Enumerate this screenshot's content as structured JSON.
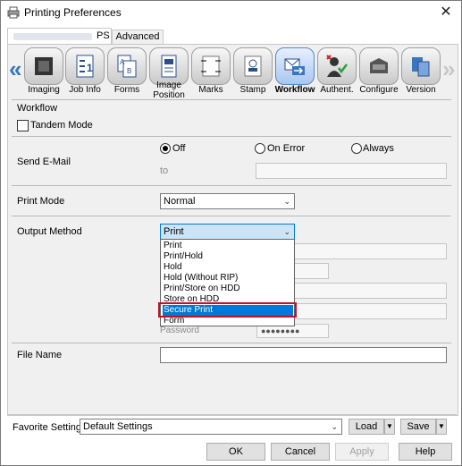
{
  "window": {
    "title": "Printing Preferences",
    "close_symbol": "✕"
  },
  "tabs": {
    "ps": "PS",
    "advanced": "Advanced"
  },
  "toolbar": {
    "prev_arrow": "«",
    "next_arrow": "»",
    "items": [
      {
        "label": "Imaging",
        "icon": "imaging-icon"
      },
      {
        "label": "Job Info",
        "icon": "job-info-icon"
      },
      {
        "label": "Forms",
        "icon": "forms-icon"
      },
      {
        "label": "Image Position",
        "icon": "image-position-icon"
      },
      {
        "label": "Marks",
        "icon": "marks-icon"
      },
      {
        "label": "Stamp",
        "icon": "stamp-icon"
      },
      {
        "label": "Workflow",
        "icon": "workflow-icon",
        "active": true
      },
      {
        "label": "Authent.",
        "icon": "authentication-icon"
      },
      {
        "label": "Configure",
        "icon": "configure-icon"
      },
      {
        "label": "Version",
        "icon": "version-icon"
      }
    ]
  },
  "workflow": {
    "section_title": "Workflow",
    "tandem_mode": "Tandem Mode",
    "send_email": {
      "label": "Send E-Mail",
      "options": [
        "Off",
        "On Error",
        "Always"
      ],
      "selected": "Off",
      "to_label": "to"
    },
    "print_mode": {
      "label": "Print Mode",
      "value": "Normal"
    },
    "output_method": {
      "label": "Output Method",
      "value": "Print",
      "options": [
        "Print",
        "Print/Hold",
        "Hold",
        "Hold (Without RIP)",
        "Print/Store on HDD",
        "Store on HDD",
        "Secure Print",
        "Form"
      ],
      "highlighted": "Secure Print"
    },
    "password_label": "Password",
    "password_mask": "●●●●●●●●",
    "file_name": {
      "label": "File Name",
      "value": ""
    }
  },
  "favorites": {
    "label": "Favorite Setting",
    "value": "Default Settings",
    "load": "Load",
    "save": "Save"
  },
  "buttons": {
    "ok": "OK",
    "cancel": "Cancel",
    "apply": "Apply",
    "help": "Help"
  },
  "colors": {
    "accent": "#0078d7",
    "highlight_box": "#c0102a"
  }
}
